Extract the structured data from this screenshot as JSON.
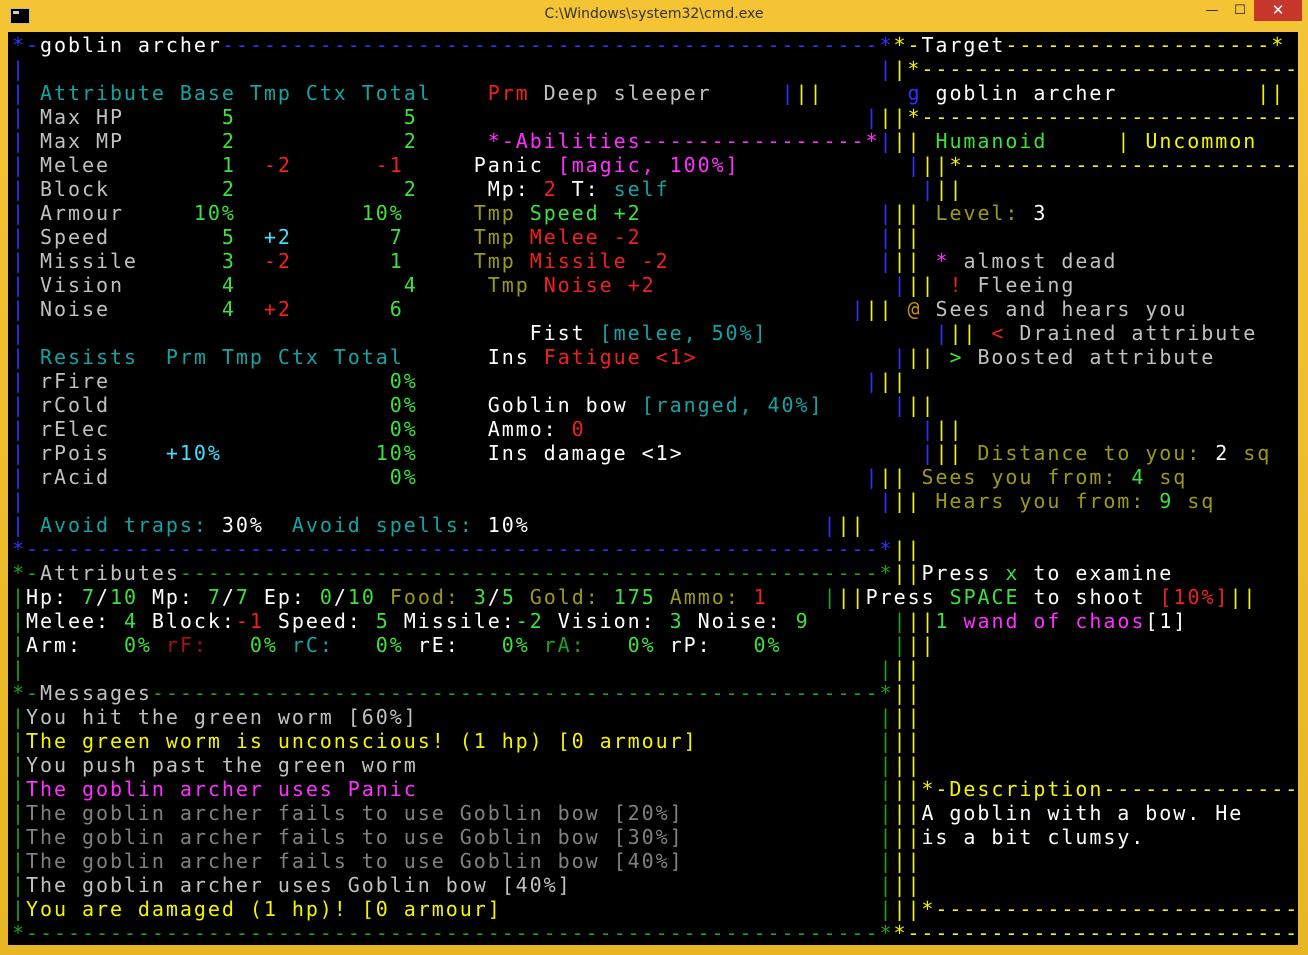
{
  "window": {
    "title": "C:\\Windows\\system32\\cmd.exe",
    "min": "—",
    "max": "☐",
    "close": "✕"
  },
  "colors": {
    "blue": "#3030ff",
    "teal": "#13a3a3",
    "green": "#3ee03e",
    "red": "#f02020",
    "cyan": "#40e0ff",
    "magenta": "#ff30ff",
    "yellow": "#f4f400",
    "olive": "#9a9a18",
    "white": "#ffffff",
    "gray": "#c0c0c0",
    "dgray": "#808080",
    "dred": "#a81010",
    "dgreen": "#1fa01f",
    "orange": "#c89010"
  },
  "lines": [
    [
      [
        "blue",
        "*-"
      ],
      [
        "white",
        "goblin archer"
      ],
      [
        "blue",
        "-----------------------------------------------*"
      ],
      [
        "yellow",
        "*-"
      ],
      [
        "white",
        "Target"
      ],
      [
        "yellow",
        "-------------------*"
      ]
    ],
    [
      [
        "blue",
        "|                                                             |"
      ],
      [
        "yellow",
        "|*------------------------------*|"
      ]
    ],
    [
      [
        "blue",
        "| "
      ],
      [
        "teal",
        "Attribute Base Tmp Ctx Total"
      ],
      [
        "blue",
        "    "
      ],
      [
        "red",
        "Prm "
      ],
      [
        "gray",
        "Deep sleeper"
      ],
      [
        "blue",
        "     |"
      ],
      [
        "yellow",
        "||"
      ],
      [
        "blue",
        "      g "
      ],
      [
        "white",
        "goblin archer"
      ],
      [
        "yellow",
        "          ||"
      ]
    ],
    [
      [
        "blue",
        "| "
      ],
      [
        "gray",
        "Max HP       "
      ],
      [
        "green",
        "5            5"
      ],
      [
        "blue",
        "                                |"
      ],
      [
        "yellow",
        "||*------------------------------*|"
      ]
    ],
    [
      [
        "blue",
        "| "
      ],
      [
        "gray",
        "Max MP       "
      ],
      [
        "green",
        "2            2"
      ],
      [
        "blue",
        "     "
      ],
      [
        "magenta",
        "*-Abilities----------------*"
      ],
      [
        "blue",
        "|"
      ],
      [
        "yellow",
        "|| "
      ],
      [
        "green",
        "Humanoid"
      ],
      [
        "yellow",
        "     | "
      ],
      [
        "yellow",
        "Uncommon"
      ],
      [
        "yellow",
        "      ||"
      ]
    ],
    [
      [
        "blue",
        "| "
      ],
      [
        "gray",
        "Melee        "
      ],
      [
        "green",
        "1  "
      ],
      [
        "red",
        "-2      -1"
      ],
      [
        "blue",
        "     "
      ],
      [
        "white",
        "Panic "
      ],
      [
        "magenta",
        "[magic, 100%]"
      ],
      [
        "blue",
        "            |"
      ],
      [
        "yellow",
        "||*------------------------------*|"
      ]
    ],
    [
      [
        "blue",
        "| "
      ],
      [
        "gray",
        "Block        "
      ],
      [
        "green",
        "2            2"
      ],
      [
        "blue",
        "     "
      ],
      [
        "white",
        "Mp: "
      ],
      [
        "red",
        "2"
      ],
      [
        "white",
        " T: "
      ],
      [
        "teal",
        "self"
      ],
      [
        "blue",
        "                  |"
      ],
      [
        "yellow",
        "||                                ||"
      ]
    ],
    [
      [
        "blue",
        "| "
      ],
      [
        "gray",
        "Armour     "
      ],
      [
        "green",
        "10%         10%"
      ],
      [
        "blue",
        "     "
      ],
      [
        "olive",
        "Tmp "
      ],
      [
        "green",
        "Speed +2"
      ],
      [
        "blue",
        "                 |"
      ],
      [
        "yellow",
        "|| "
      ],
      [
        "olive",
        "Level: "
      ],
      [
        "white",
        "3"
      ],
      [
        "yellow",
        "                      ||"
      ]
    ],
    [
      [
        "blue",
        "| "
      ],
      [
        "gray",
        "Speed        "
      ],
      [
        "green",
        "5  "
      ],
      [
        "cyan",
        "+2"
      ],
      [
        "green",
        "       7"
      ],
      [
        "blue",
        "     "
      ],
      [
        "olive",
        "Tmp "
      ],
      [
        "red",
        "Melee -2"
      ],
      [
        "blue",
        "                 |"
      ],
      [
        "yellow",
        "||                                ||"
      ]
    ],
    [
      [
        "blue",
        "| "
      ],
      [
        "gray",
        "Missile      "
      ],
      [
        "green",
        "3  "
      ],
      [
        "red",
        "-2"
      ],
      [
        "green",
        "       1"
      ],
      [
        "blue",
        "     "
      ],
      [
        "olive",
        "Tmp "
      ],
      [
        "red",
        "Missile -2"
      ],
      [
        "blue",
        "               |"
      ],
      [
        "yellow",
        "|| "
      ],
      [
        "magenta",
        "* "
      ],
      [
        "gray",
        "almost dead"
      ],
      [
        "yellow",
        "                 ||"
      ]
    ],
    [
      [
        "blue",
        "| "
      ],
      [
        "gray",
        "Vision       "
      ],
      [
        "green",
        "4            4"
      ],
      [
        "blue",
        "     "
      ],
      [
        "olive",
        "Tmp "
      ],
      [
        "red",
        "Noise +2"
      ],
      [
        "blue",
        "                 |"
      ],
      [
        "yellow",
        "|| "
      ],
      [
        "red",
        "! "
      ],
      [
        "gray",
        "Fleeing"
      ],
      [
        "yellow",
        "                     ||"
      ]
    ],
    [
      [
        "blue",
        "| "
      ],
      [
        "gray",
        "Noise        "
      ],
      [
        "green",
        "4  "
      ],
      [
        "red",
        "+2"
      ],
      [
        "green",
        "       6"
      ],
      [
        "blue",
        "                                |"
      ],
      [
        "yellow",
        "|| "
      ],
      [
        "orange",
        "@ "
      ],
      [
        "gray",
        "Sees and hears you"
      ],
      [
        "yellow",
        "          ||"
      ]
    ],
    [
      [
        "blue",
        "|                                    "
      ],
      [
        "white",
        "Fist "
      ],
      [
        "teal",
        "[melee, 50%]"
      ],
      [
        "blue",
        "            |"
      ],
      [
        "yellow",
        "|| "
      ],
      [
        "red",
        "< "
      ],
      [
        "gray",
        "Drained attribute"
      ],
      [
        "yellow",
        "           ||"
      ]
    ],
    [
      [
        "blue",
        "| "
      ],
      [
        "teal",
        "Resists  Prm Tmp Ctx Total"
      ],
      [
        "blue",
        "      "
      ],
      [
        "white",
        "Ins "
      ],
      [
        "red",
        "Fatigue <1>"
      ],
      [
        "blue",
        "              |"
      ],
      [
        "yellow",
        "|| "
      ],
      [
        "green",
        "> "
      ],
      [
        "gray",
        "Boosted attribute"
      ],
      [
        "yellow",
        "           ||"
      ]
    ],
    [
      [
        "blue",
        "| "
      ],
      [
        "gray",
        "rFire                    "
      ],
      [
        "green",
        "0%"
      ],
      [
        "blue",
        "                                |"
      ],
      [
        "yellow",
        "||                                ||"
      ]
    ],
    [
      [
        "blue",
        "| "
      ],
      [
        "gray",
        "rCold                    "
      ],
      [
        "green",
        "0%"
      ],
      [
        "blue",
        "     "
      ],
      [
        "white",
        "Goblin bow "
      ],
      [
        "teal",
        "[ranged, 40%]"
      ],
      [
        "blue",
        "     |"
      ],
      [
        "yellow",
        "||                                ||"
      ]
    ],
    [
      [
        "blue",
        "| "
      ],
      [
        "gray",
        "rElec                    "
      ],
      [
        "green",
        "0%"
      ],
      [
        "blue",
        "     "
      ],
      [
        "white",
        "Ammo: "
      ],
      [
        "red",
        "0"
      ],
      [
        "blue",
        "                        |"
      ],
      [
        "yellow",
        "||                                ||"
      ]
    ],
    [
      [
        "blue",
        "| "
      ],
      [
        "gray",
        "rPois    "
      ],
      [
        "cyan",
        "+10%"
      ],
      [
        "green",
        "           10%"
      ],
      [
        "blue",
        "     "
      ],
      [
        "white",
        "Ins damage <1>"
      ],
      [
        "blue",
        "                 |"
      ],
      [
        "yellow",
        "|| "
      ],
      [
        "olive",
        "Distance to you: "
      ],
      [
        "white",
        "2 "
      ],
      [
        "olive",
        "sq"
      ],
      [
        "yellow",
        "          ||"
      ]
    ],
    [
      [
        "blue",
        "| "
      ],
      [
        "gray",
        "rAcid                    "
      ],
      [
        "green",
        "0%"
      ],
      [
        "blue",
        "                                |"
      ],
      [
        "yellow",
        "|| "
      ],
      [
        "olive",
        "Sees you from: "
      ],
      [
        "green",
        "4 "
      ],
      [
        "olive",
        "sq"
      ],
      [
        "yellow",
        "            ||"
      ]
    ],
    [
      [
        "blue",
        "|                                                             |"
      ],
      [
        "yellow",
        "|| "
      ],
      [
        "olive",
        "Hears you from: "
      ],
      [
        "green",
        "9 "
      ],
      [
        "olive",
        "sq"
      ],
      [
        "yellow",
        "           ||"
      ]
    ],
    [
      [
        "blue",
        "| "
      ],
      [
        "teal",
        "Avoid traps: "
      ],
      [
        "white",
        "30%"
      ],
      [
        "blue",
        "  "
      ],
      [
        "teal",
        "Avoid spells: "
      ],
      [
        "white",
        "10%"
      ],
      [
        "blue",
        "                     |"
      ],
      [
        "yellow",
        "||                                ||"
      ]
    ],
    [
      [
        "blue",
        "*-------------------------------------------------------------*"
      ],
      [
        "yellow",
        "||                                ||"
      ]
    ],
    [
      [
        "dgreen",
        "*-"
      ],
      [
        "gray",
        "Attributes"
      ],
      [
        "dgreen",
        "--------------------------------------------------*"
      ],
      [
        "yellow",
        "||"
      ],
      [
        "white",
        "Press "
      ],
      [
        "green",
        "x"
      ],
      [
        "white",
        " to examine"
      ],
      [
        "yellow",
        "              ||"
      ]
    ],
    [
      [
        "dgreen",
        "|"
      ],
      [
        "white",
        "Hp: "
      ],
      [
        "green",
        "7"
      ],
      [
        "white",
        "/"
      ],
      [
        "green",
        "10"
      ],
      [
        "white",
        " Mp: "
      ],
      [
        "green",
        "7"
      ],
      [
        "white",
        "/"
      ],
      [
        "green",
        "7"
      ],
      [
        "white",
        " Ep: "
      ],
      [
        "green",
        "0"
      ],
      [
        "white",
        "/"
      ],
      [
        "green",
        "10"
      ],
      [
        "olive",
        " Food: "
      ],
      [
        "green",
        "3"
      ],
      [
        "white",
        "/"
      ],
      [
        "green",
        "5"
      ],
      [
        "olive",
        " Gold: "
      ],
      [
        "green",
        "175"
      ],
      [
        "olive",
        " Ammo: "
      ],
      [
        "red",
        "1"
      ],
      [
        "dgreen",
        "    |"
      ],
      [
        "yellow",
        "||"
      ],
      [
        "white",
        "Press "
      ],
      [
        "green",
        "SPACE"
      ],
      [
        "white",
        " to shoot "
      ],
      [
        "red",
        "[10%]"
      ],
      [
        "yellow",
        "||"
      ]
    ],
    [
      [
        "dgreen",
        "|"
      ],
      [
        "white",
        "Melee: "
      ],
      [
        "green",
        "4"
      ],
      [
        "white",
        " Block:"
      ],
      [
        "red",
        "-1"
      ],
      [
        "white",
        " Speed: "
      ],
      [
        "green",
        "5"
      ],
      [
        "white",
        " Missile:"
      ],
      [
        "green",
        "-2"
      ],
      [
        "white",
        " Vision: "
      ],
      [
        "green",
        "3"
      ],
      [
        "white",
        " Noise: "
      ],
      [
        "green",
        "9"
      ],
      [
        "dgreen",
        "      |"
      ],
      [
        "yellow",
        "||"
      ],
      [
        "green",
        "1 "
      ],
      [
        "magenta",
        "wand of chaos"
      ],
      [
        "white",
        "[1]"
      ],
      [
        "yellow",
        "              ||"
      ]
    ],
    [
      [
        "dgreen",
        "|"
      ],
      [
        "white",
        "Arm:   "
      ],
      [
        "green",
        "0%"
      ],
      [
        "dred",
        " rF:   "
      ],
      [
        "green",
        "0%"
      ],
      [
        "teal",
        " rC:   "
      ],
      [
        "green",
        "0%"
      ],
      [
        "white",
        " rE:   "
      ],
      [
        "green",
        "0%"
      ],
      [
        "dgreen",
        " rA:   "
      ],
      [
        "green",
        "0%"
      ],
      [
        "white",
        " rP:   "
      ],
      [
        "green",
        "0%"
      ],
      [
        "dgreen",
        "        |"
      ],
      [
        "yellow",
        "||                                ||"
      ]
    ],
    [
      [
        "dgreen",
        "|                                                             |"
      ],
      [
        "yellow",
        "||                                ||"
      ]
    ],
    [
      [
        "dgreen",
        "*-"
      ],
      [
        "gray",
        "Messages"
      ],
      [
        "dgreen",
        "----------------------------------------------------*"
      ],
      [
        "yellow",
        "||                                ||"
      ]
    ],
    [
      [
        "dgreen",
        "|"
      ],
      [
        "gray",
        "You hit the green worm [60%]"
      ],
      [
        "dgreen",
        "                                 |"
      ],
      [
        "yellow",
        "||                                ||"
      ]
    ],
    [
      [
        "dgreen",
        "|"
      ],
      [
        "yellow",
        "The green worm is unconscious! (1 hp) [0 armour]"
      ],
      [
        "dgreen",
        "             |"
      ],
      [
        "yellow",
        "||                                ||"
      ]
    ],
    [
      [
        "dgreen",
        "|"
      ],
      [
        "gray",
        "You push past the green worm"
      ],
      [
        "dgreen",
        "                                 |"
      ],
      [
        "yellow",
        "||                                ||"
      ]
    ],
    [
      [
        "dgreen",
        "|"
      ],
      [
        "magenta",
        "The goblin archer uses Panic"
      ],
      [
        "dgreen",
        "                                 |"
      ],
      [
        "yellow",
        "||*-Description------------------*|"
      ]
    ],
    [
      [
        "dgreen",
        "|"
      ],
      [
        "dgray",
        "The goblin archer fails to use Goblin bow [20%]"
      ],
      [
        "dgreen",
        "              |"
      ],
      [
        "yellow",
        "||"
      ],
      [
        "white",
        "A goblin with a bow. He"
      ],
      [
        "yellow",
        "         ||"
      ]
    ],
    [
      [
        "dgreen",
        "|"
      ],
      [
        "dgray",
        "The goblin archer fails to use Goblin bow [30%]"
      ],
      [
        "dgreen",
        "              |"
      ],
      [
        "yellow",
        "||"
      ],
      [
        "white",
        "is a bit clumsy."
      ],
      [
        "yellow",
        "                ||"
      ]
    ],
    [
      [
        "dgreen",
        "|"
      ],
      [
        "dgray",
        "The goblin archer fails to use Goblin bow [40%]"
      ],
      [
        "dgreen",
        "              |"
      ],
      [
        "yellow",
        "||                                ||"
      ]
    ],
    [
      [
        "dgreen",
        "|"
      ],
      [
        "gray",
        "The goblin archer uses Goblin bow [40%]"
      ],
      [
        "dgreen",
        "                      |"
      ],
      [
        "yellow",
        "||                                ||"
      ]
    ],
    [
      [
        "dgreen",
        "|"
      ],
      [
        "yellow",
        "You are damaged (1 hp)! [0 armour]"
      ],
      [
        "dgreen",
        "                           |"
      ],
      [
        "yellow",
        "||*------------------------------*|"
      ]
    ],
    [
      [
        "dgreen",
        "*-------------------------------------------------------------*"
      ],
      [
        "yellow",
        "*--------------------------------*"
      ]
    ]
  ]
}
